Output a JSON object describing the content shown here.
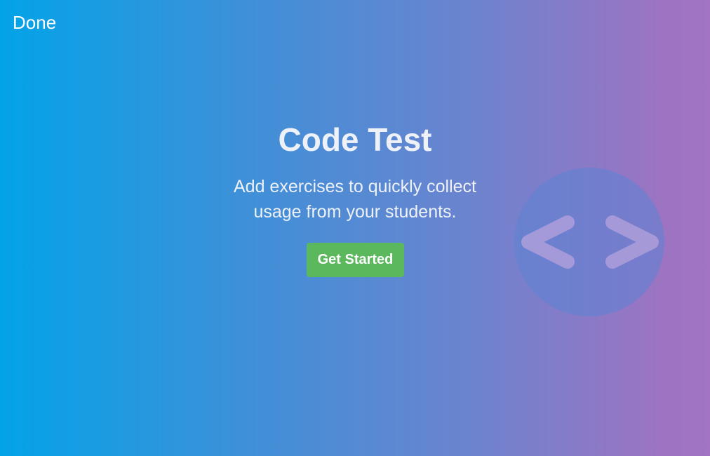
{
  "header": {
    "done_label": "Done"
  },
  "hero": {
    "title": "Code Test",
    "subtitle": "Add exercises to quickly collect usage from your students.",
    "cta_label": "Get Started"
  },
  "decoration": {
    "icon": "code-brackets-icon"
  },
  "colors": {
    "gradient_start": "#03a3e8",
    "gradient_end": "#a274c2",
    "button": "#5cb85c",
    "text": "#eef1f7"
  }
}
